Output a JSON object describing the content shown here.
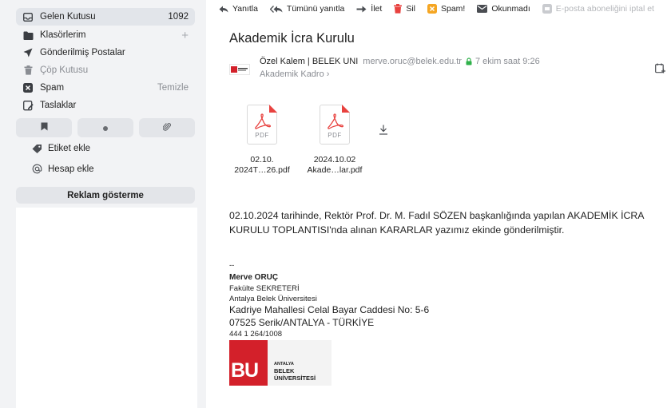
{
  "sidebar": {
    "folders": [
      {
        "label": "Gelen Kutusu",
        "count": "1092",
        "icon": "inbox-icon"
      },
      {
        "label": "Klasörlerim",
        "action": "+",
        "icon": "folder-icon"
      },
      {
        "label": "Gönderilmiş Postalar",
        "icon": "send-icon"
      },
      {
        "label": "Çöp Kutusu",
        "icon": "trash-icon"
      },
      {
        "label": "Spam",
        "action": "Temizle",
        "icon": "spam-icon"
      },
      {
        "label": "Taslaklar",
        "icon": "draft-icon"
      }
    ],
    "quick_filters": [
      "bookmark-icon",
      "dot-icon",
      "paperclip-icon"
    ],
    "add_label": "Etiket ekle",
    "add_account": "Hesap ekle",
    "ad_button": "Reklam gösterme"
  },
  "toolbar": {
    "reply": "Yanıtla",
    "reply_all": "Tümünü yanıtla",
    "forward": "İlet",
    "delete": "Sil",
    "spam": "Spam!",
    "unread": "Okunmadı",
    "unsubscribe": "E-posta aboneliğini iptal et"
  },
  "message": {
    "subject": "Akademik İcra Kurulu",
    "sender_name": "Özel Kalem | BELEK UNI",
    "sender_email": "merve.oruc@belek.edu.tr",
    "date": "7 ekim saat 9:26",
    "folder": "Akademik Kadro",
    "folder_chevron": "›",
    "attachments": [
      {
        "name_line1": "02.10.",
        "name_line2": "2024T…26.pdf",
        "ext": "PDF"
      },
      {
        "name_line1": "2024.10.02",
        "name_line2": "Akade…lar.pdf",
        "ext": "PDF"
      }
    ],
    "body": "02.10.2024 tarihinde, Rektör Prof. Dr. M. Fadıl SÖZEN başkanlığında yapılan AKADEMİK İCRA KURULU TOPLANTISI'nda alınan KARARLAR yazımız ekinde gönderilmiştir."
  },
  "signature": {
    "separator": "--",
    "name": "Merve ORUÇ",
    "title": "Fakülte SEKRETERİ",
    "institution": "Antalya Belek Üniversitesi",
    "address1": "Kadriye Mahallesi Celal Bayar Caddesi No: 5-6",
    "address2": "07525 Serik/ANTALYA - TÜRKİYE",
    "phone": "444 1 264/1008",
    "logo": {
      "letters": "BU",
      "line1": "ANTALYA",
      "line2": "BELEK",
      "line3": "ÜNİVERSİTESİ"
    }
  },
  "colors": {
    "sidebar_bg": "#f2f3f5",
    "active_item_bg": "#e2e5ea",
    "pdf_red": "#e8423f",
    "brand_red": "#d3202a",
    "secure_green": "#2fb14a"
  }
}
